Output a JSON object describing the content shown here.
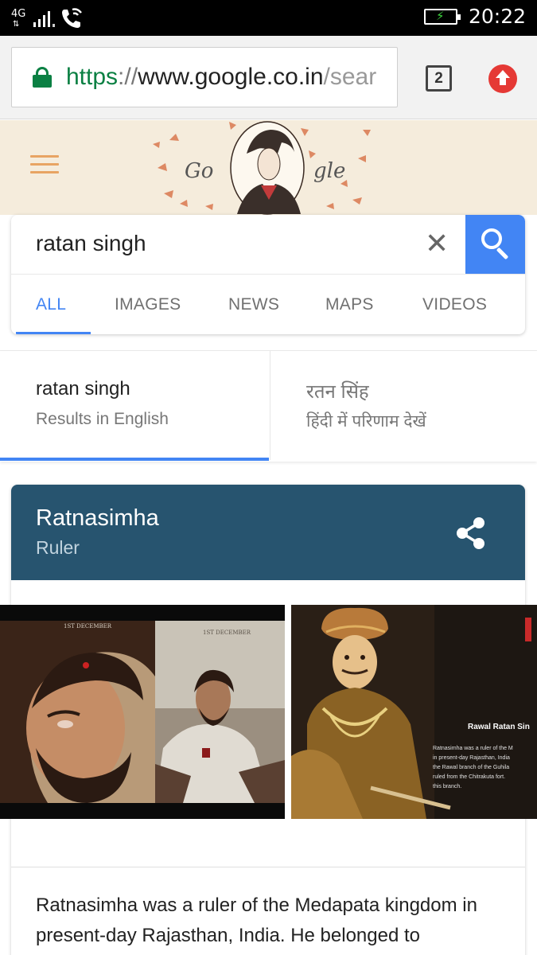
{
  "status_bar": {
    "network_type": "4G",
    "time": "20:22"
  },
  "url_bar": {
    "scheme": "https",
    "separator": "://",
    "host": "www.google.co.in",
    "path": "/sear",
    "tab_count": "2"
  },
  "search": {
    "query": "ratan singh",
    "tabs": [
      "ALL",
      "IMAGES",
      "NEWS",
      "MAPS",
      "VIDEOS"
    ],
    "active_tab": "ALL"
  },
  "language_options": [
    {
      "title": "ratan singh",
      "subtitle": "Results in English"
    },
    {
      "title": "रतन सिंह",
      "subtitle": "हिंदी में परिणाम देखें"
    }
  ],
  "knowledge_panel": {
    "title": "Ratnasimha",
    "subtitle": "Ruler",
    "description": "Ratnasimha was a ruler of the Medapata kingdom in present-day Rajasthan, India. He belonged to"
  },
  "images": [
    {
      "caption_top": "1ST DECEMBER",
      "caption_top_2": "1ST DECEMBER"
    },
    {
      "title": "Rawal Ratan Sin",
      "text": "Ratnasimha was a ruler of the M in present-day Rajasthan, India the Rawal branch of the Guhila ruled from the Chitrakuta fort. this branch."
    }
  ],
  "colors": {
    "accent": "#4285f4",
    "kp_header": "#27546f",
    "secure_green": "#0b8043",
    "doodle_bg": "#f5ecdc"
  }
}
